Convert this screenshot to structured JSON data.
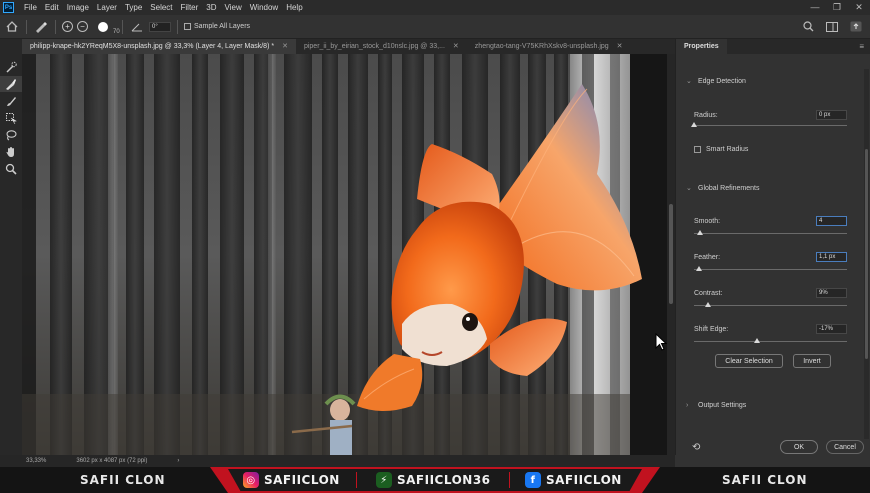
{
  "menubar": {
    "logo": "Ps",
    "items": [
      "File",
      "Edit",
      "Image",
      "Layer",
      "Type",
      "Select",
      "Filter",
      "3D",
      "View",
      "Window",
      "Help"
    ],
    "controls": [
      "—",
      "❐",
      "✕"
    ]
  },
  "options": {
    "brush_size": "70",
    "angle": "0°",
    "sample_all_layers": "Sample All Layers"
  },
  "tabs": [
    {
      "label": "philipp-knape-hk2YReqM5X8-unsplash.jpg @ 33,3% (Layer 4, Layer Mask/8) *",
      "close": "✕"
    },
    {
      "label": "piper_ii_by_eirian_stock_d10nslc.jpg @ 33,...",
      "close": "✕"
    },
    {
      "label": "zhengtao-tang-V75KRhXskv8-unsplash.jpg",
      "close": "✕"
    }
  ],
  "properties": {
    "tab": "Properties",
    "menu": "≡",
    "edge_detection": "Edge Detection",
    "radius_label": "Radius:",
    "radius_value": "0 px",
    "radius_level": 0,
    "smart_radius": "Smart Radius",
    "global_refinements": "Global Refinements",
    "smooth_label": "Smooth:",
    "smooth_value": "4",
    "smooth_level": 4,
    "feather_label": "Feather:",
    "feather_value": "1,1 px",
    "feather_level": 3,
    "contrast_label": "Contrast:",
    "contrast_value": "9%",
    "contrast_level": 9,
    "shift_edge_label": "Shift Edge:",
    "shift_edge_value": "-17%",
    "shift_edge_level": 41.5,
    "clear_selection": "Clear Selection",
    "invert": "Invert",
    "output_settings": "Output Settings",
    "ok": "OK",
    "cancel": "Cancel"
  },
  "status": {
    "zoom": "33,33%",
    "dimensions": "3602 px x 4087 px (72 ppi)",
    "chevron": "›"
  },
  "banner": {
    "left_text": "SAFII CLON",
    "right_text": "SAFII CLON",
    "instagram": "SAFIICLON",
    "other": "SAFIICLON36",
    "facebook": "SAFIICLON"
  },
  "colors": {
    "accent_red": "#c1121f",
    "panel": "#323232",
    "fish_orange": "#f26a1b",
    "fin_blue": "#5a7fd0"
  }
}
